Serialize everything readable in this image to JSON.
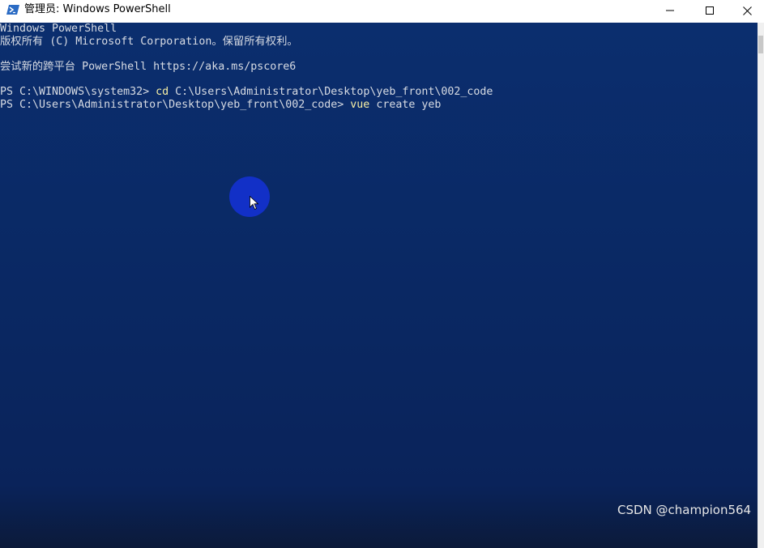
{
  "window": {
    "title": "管理员: Windows PowerShell",
    "icon": "powershell-icon",
    "controls": {
      "minimize": "minimize-icon",
      "maximize": "maximize-icon",
      "close": "close-icon"
    }
  },
  "console": {
    "background_color": "#0b2e6e",
    "text_color": "#d7dbe3",
    "command_color": "#f9f1a5",
    "lines": [
      {
        "text": "Windows PowerShell"
      },
      {
        "text": "版权所有 (C) Microsoft Corporation。保留所有权利。"
      },
      {
        "text": ""
      },
      {
        "text": "尝试新的跨平台 PowerShell https://aka.ms/pscore6"
      },
      {
        "text": ""
      },
      {
        "prompt": "PS C:\\WINDOWS\\system32> ",
        "command": "cd",
        "args": " C:\\Users\\Administrator\\Desktop\\yeb_front\\002_code"
      },
      {
        "prompt": "PS C:\\Users\\Administrator\\Desktop\\yeb_front\\002_code> ",
        "command": "vue",
        "args": " create yeb"
      }
    ]
  },
  "overlay": {
    "cursor_highlight_color": "#1230c7",
    "pointer": "mouse-pointer-icon"
  },
  "watermark": "CSDN @champion564"
}
